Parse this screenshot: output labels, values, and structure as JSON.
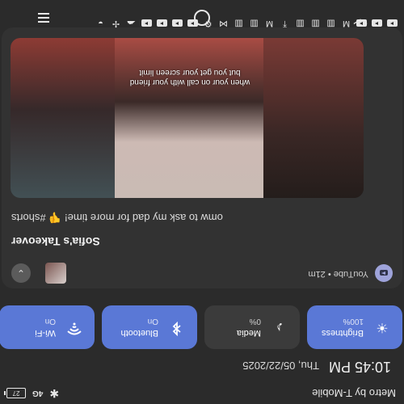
{
  "status_bar": {
    "carrier": "Metro by T-Mobile",
    "bluetooth_icon": "bluetooth-icon",
    "network": "4G",
    "battery": "27"
  },
  "datetime": {
    "time": "10:45 PM",
    "date": "Thu, 05/22/2025"
  },
  "quick_tiles": [
    {
      "label": "Wi-Fi",
      "status": "On",
      "icon": "wifi-icon",
      "active": true
    },
    {
      "label": "Bluetooth",
      "status": "On",
      "icon": "bluetooth-icon",
      "active": true
    },
    {
      "label": "Media",
      "status": "0%",
      "icon": "music-note-icon",
      "active": false
    },
    {
      "label": "Brightness",
      "status": "100%",
      "icon": "sun-icon",
      "active": true
    }
  ],
  "media_card": {
    "app_line": "YouTube • 21m",
    "title": "Sofia's Takeover",
    "subtitle": "omw to ask my dad for more time! 👎 #shorts",
    "video_caption": "when your on call with your friend but you get your screen limit"
  },
  "colors": {
    "background": "#2b2b2b",
    "tile_active": "#5a78d6",
    "tile_inactive": "#3b3b3b"
  }
}
